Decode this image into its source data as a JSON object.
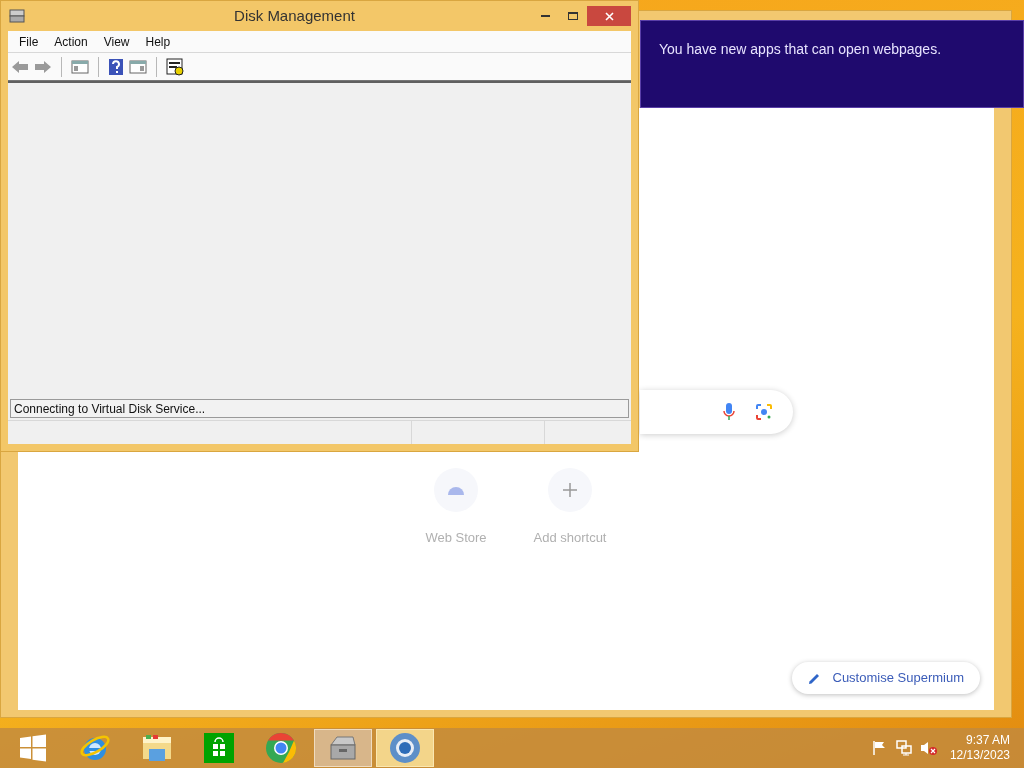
{
  "disk_window": {
    "title": "Disk Management",
    "menu": [
      "File",
      "Action",
      "View",
      "Help"
    ],
    "toolbar": [
      {
        "kind": "back",
        "disabled": true
      },
      {
        "kind": "forward",
        "disabled": true
      },
      {
        "kind": "separator"
      },
      {
        "kind": "console-tree"
      },
      {
        "kind": "separator"
      },
      {
        "kind": "help"
      },
      {
        "kind": "action-pane"
      },
      {
        "kind": "separator"
      },
      {
        "kind": "properties"
      }
    ],
    "status_text": "Connecting to Virtual Disk Service..."
  },
  "notification": {
    "message": "You have new apps that can open webpages."
  },
  "browser": {
    "shortcuts": [
      {
        "kind": "webstore",
        "label": "Web Store"
      },
      {
        "kind": "add",
        "label": "Add shortcut"
      }
    ],
    "customise_button": "Customise Supermium"
  },
  "taskbar": {
    "items": [
      {
        "kind": "start",
        "running": false,
        "selected": false
      },
      {
        "kind": "ie",
        "running": false,
        "selected": false
      },
      {
        "kind": "explorer",
        "running": false,
        "selected": false
      },
      {
        "kind": "store",
        "running": false,
        "selected": false
      },
      {
        "kind": "chrome",
        "running": false,
        "selected": false
      },
      {
        "kind": "disk",
        "running": true,
        "selected": false
      },
      {
        "kind": "supermium",
        "running": true,
        "selected": true
      }
    ],
    "tray": [
      {
        "kind": "flag"
      },
      {
        "kind": "network"
      },
      {
        "kind": "volume-muted"
      }
    ],
    "time": "9:37 AM",
    "date": "12/13/2023"
  }
}
